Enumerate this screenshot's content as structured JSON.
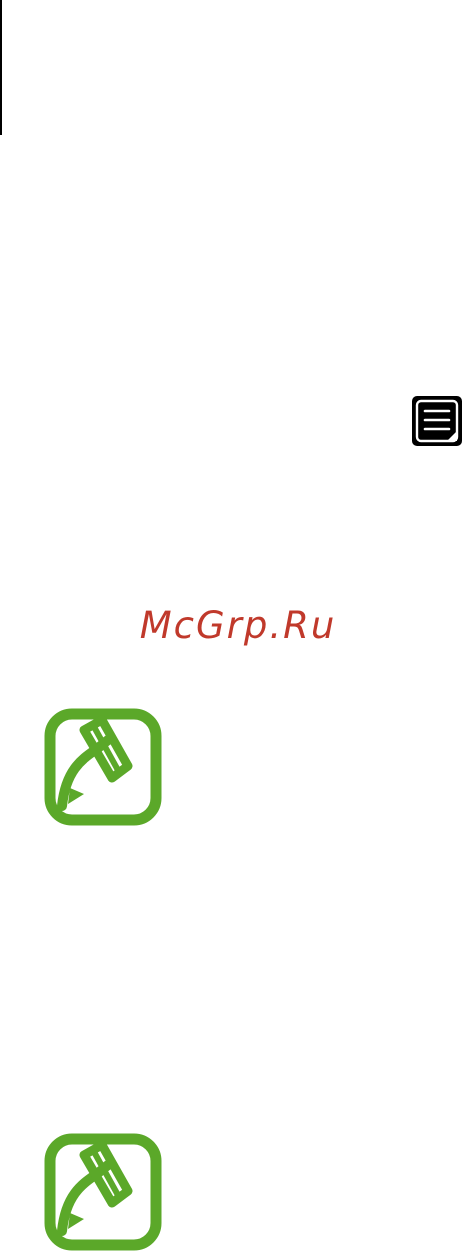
{
  "watermark": {
    "text": "McGrp.Ru",
    "color": "#c0392b"
  },
  "icons": {
    "menu_key": "menu-key-icon",
    "note": "note-pencil-icon"
  },
  "colors": {
    "note_icon_green": "#5ba829",
    "menu_key_background": "#000000"
  }
}
